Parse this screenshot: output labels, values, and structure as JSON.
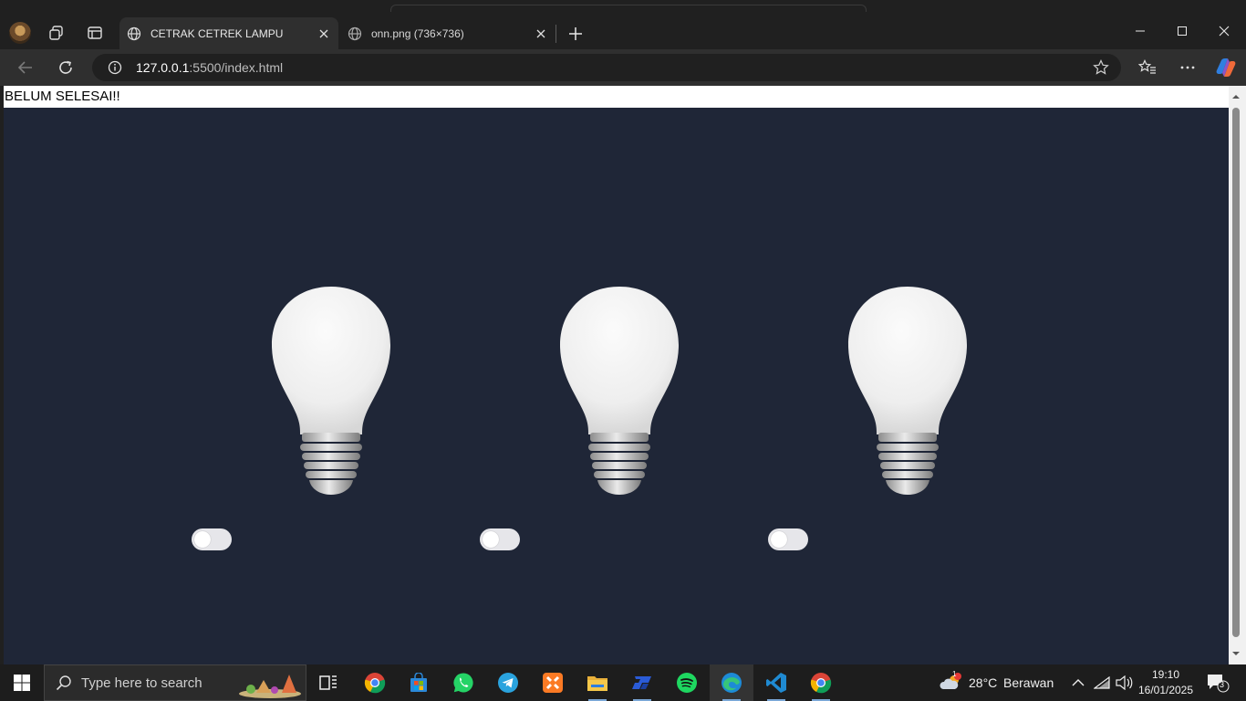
{
  "browser": {
    "tabs": [
      {
        "title": "CETRAK CETREK LAMPU",
        "active": true
      },
      {
        "title": "onn.png (736×736)",
        "active": false
      }
    ],
    "address": {
      "host": "127.0.0.1",
      "path": ":5500/index.html"
    }
  },
  "page": {
    "banner_text": "BELUM SELESAI!!",
    "background_color": "#1f2637",
    "lamps": [
      {
        "state": "off"
      },
      {
        "state": "off"
      },
      {
        "state": "off"
      }
    ]
  },
  "taskbar": {
    "search_placeholder": "Type here to search",
    "pinned_apps": [
      "task-view-icon",
      "chrome-icon",
      "microsoft-store-icon",
      "whatsapp-icon",
      "telegram-icon",
      "xampp-icon",
      "file-explorer-icon",
      "app-icon",
      "spotify-icon",
      "edge-icon",
      "vscode-icon",
      "chrome-icon"
    ],
    "weather": {
      "temperature": "28°C",
      "condition": "Berawan",
      "badge": "1"
    },
    "clock": {
      "time": "19:10",
      "date": "16/01/2025"
    },
    "notification_count": "3"
  }
}
